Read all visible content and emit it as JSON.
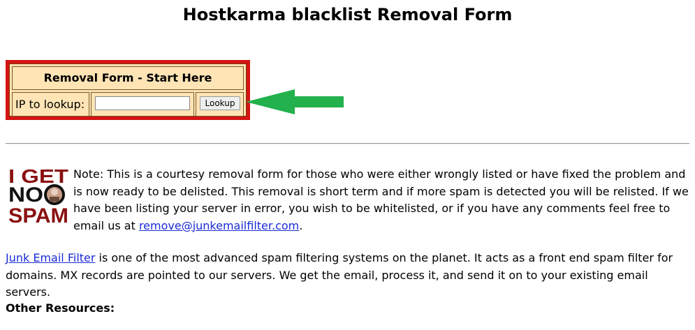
{
  "page": {
    "title": "Hostkarma blacklist Removal Form"
  },
  "form": {
    "heading": "Removal Form - Start Here",
    "ip_label": "IP to lookup:",
    "ip_value": "",
    "button_label": "Lookup"
  },
  "logo": {
    "line1": "I GET",
    "line2": "NO",
    "line3": "SPAM"
  },
  "note": {
    "text": "Note: This is a courtesy removal form for those who were either wrongly listed or have fixed the problem and is now ready to be delisted. This removal is short term and if more spam is detected you will be relisted. If we have been listing your server in error, you wish to be whitelisted, or if you have any comments feel free to email us at ",
    "email_link": "remove@junkemailfilter.com",
    "end": "."
  },
  "intro": {
    "link": "Junk Email Filter",
    "text": " is one of the most advanced spam filtering systems on the planet. It acts as a front end spam filter for domains. MX records are pointed to our servers. We get the email, process it, and send it on to your existing email servers."
  },
  "resources": {
    "heading": "Other Resources:"
  },
  "colors": {
    "form_border": "#d41414",
    "form_bg": "#ffe4b5",
    "arrow": "#22b14c",
    "link": "#1a2bd6"
  }
}
